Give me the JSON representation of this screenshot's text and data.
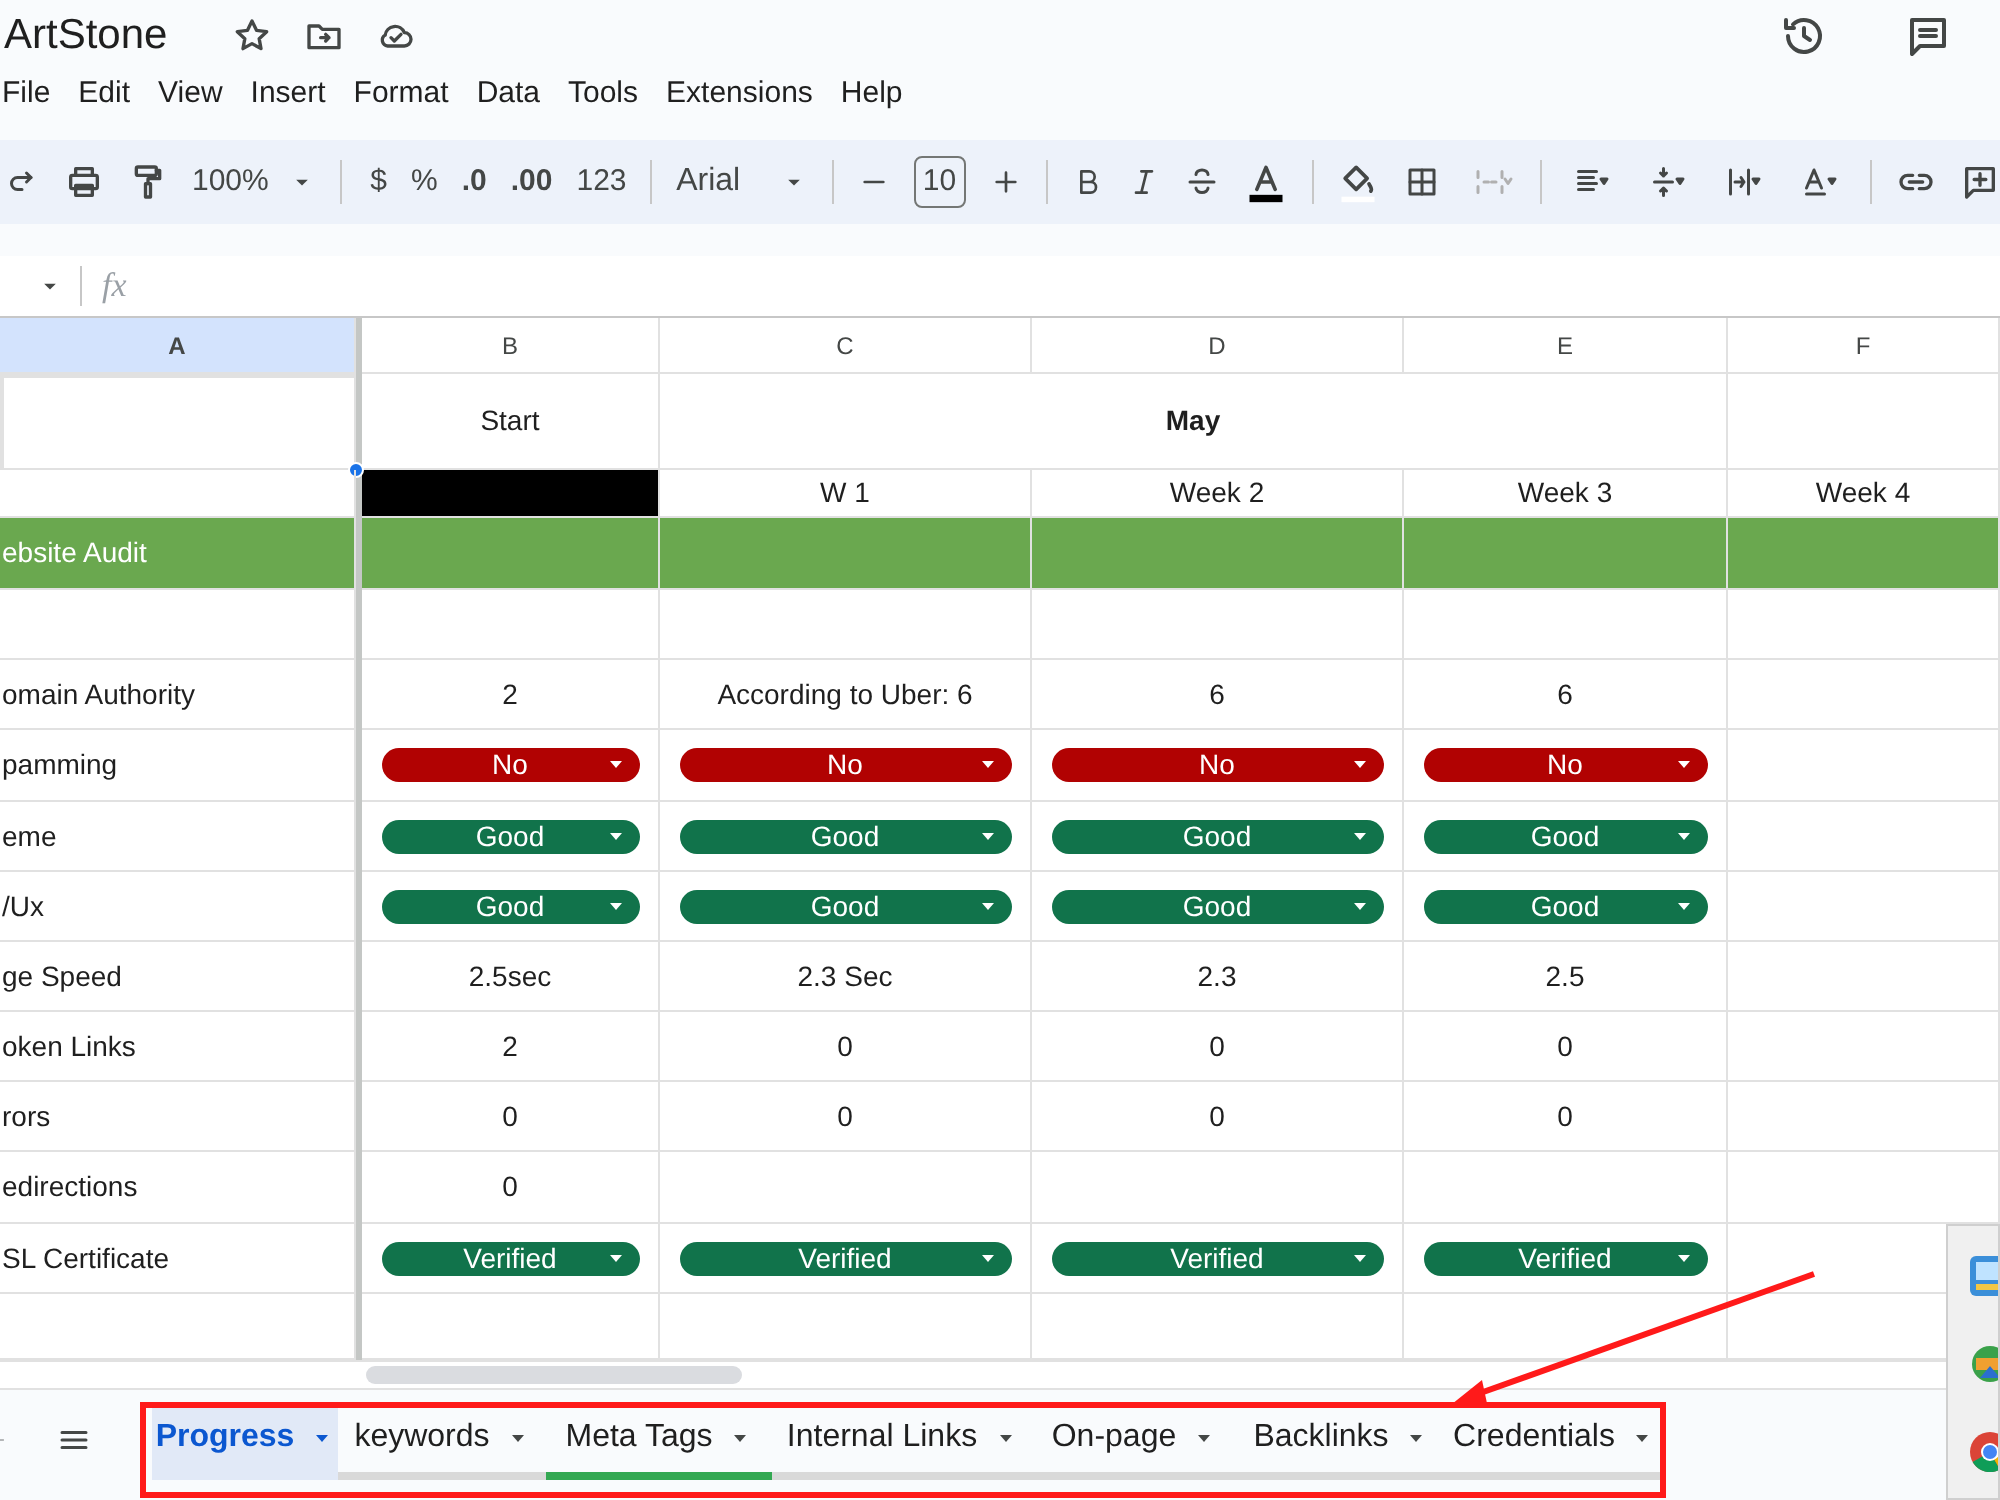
{
  "document": {
    "title": "ArtStone"
  },
  "menu": [
    "File",
    "Edit",
    "View",
    "Insert",
    "Format",
    "Data",
    "Tools",
    "Extensions",
    "Help"
  ],
  "toolbar": {
    "zoom": "100%",
    "currency": "$",
    "percent": "%",
    "decrease_decimal": ".0",
    "increase_decimal": ".00",
    "number_format": "123",
    "font": "Arial",
    "font_size": "10"
  },
  "formula_bar": {
    "fx": "fx"
  },
  "columns": [
    {
      "label": "A",
      "selected": true
    },
    {
      "label": "B",
      "selected": false
    },
    {
      "label": "C",
      "selected": false
    },
    {
      "label": "D",
      "selected": false
    },
    {
      "label": "E",
      "selected": false
    },
    {
      "label": "F",
      "selected": false
    }
  ],
  "rows": [
    {
      "kind": "header",
      "label": "",
      "selected": true,
      "cells": [
        {
          "kind": "text",
          "text": "Start"
        },
        {
          "kind": "merged",
          "text": "May"
        }
      ]
    },
    {
      "kind": "weeks",
      "label": "",
      "selected": false,
      "cells": [
        {
          "kind": "fill",
          "color": "#000000"
        },
        {
          "kind": "text",
          "text": "W 1"
        },
        {
          "kind": "text",
          "text": "Week 2"
        },
        {
          "kind": "text",
          "text": "Week 3"
        },
        {
          "kind": "text",
          "text": "Week 4"
        }
      ]
    },
    {
      "kind": "band",
      "label": "ebsite Audit",
      "selected": false,
      "color": "#6aa84f",
      "cells": []
    },
    {
      "kind": "plain",
      "label": "",
      "selected": false,
      "cells": []
    },
    {
      "kind": "plain",
      "label": "omain Authority",
      "selected": false,
      "cells": [
        {
          "kind": "text",
          "text": "2"
        },
        {
          "kind": "text",
          "text": "According to Uber: 6"
        },
        {
          "kind": "text",
          "text": "6"
        },
        {
          "kind": "text",
          "text": "6"
        }
      ]
    },
    {
      "kind": "plain",
      "label": "pamming",
      "selected": false,
      "cells": [
        {
          "kind": "chip",
          "text": "No",
          "color": "#b10202"
        },
        {
          "kind": "chip",
          "text": "No",
          "color": "#b10202"
        },
        {
          "kind": "chip",
          "text": "No",
          "color": "#b10202"
        },
        {
          "kind": "chip",
          "text": "No",
          "color": "#b10202"
        }
      ]
    },
    {
      "kind": "plain",
      "label": "eme",
      "selected": false,
      "cells": [
        {
          "kind": "chip",
          "text": "Good",
          "color": "#11734b"
        },
        {
          "kind": "chip",
          "text": "Good",
          "color": "#11734b"
        },
        {
          "kind": "chip",
          "text": "Good",
          "color": "#11734b"
        },
        {
          "kind": "chip",
          "text": "Good",
          "color": "#11734b"
        }
      ]
    },
    {
      "kind": "plain",
      "label": "/Ux",
      "selected": false,
      "cells": [
        {
          "kind": "chip",
          "text": "Good",
          "color": "#11734b"
        },
        {
          "kind": "chip",
          "text": "Good",
          "color": "#11734b"
        },
        {
          "kind": "chip",
          "text": "Good",
          "color": "#11734b"
        },
        {
          "kind": "chip",
          "text": "Good",
          "color": "#11734b"
        }
      ]
    },
    {
      "kind": "plain",
      "label": "ge Speed",
      "selected": false,
      "cells": [
        {
          "kind": "text",
          "text": "2.5sec"
        },
        {
          "kind": "text",
          "text": "2.3 Sec"
        },
        {
          "kind": "text",
          "text": "2.3"
        },
        {
          "kind": "text",
          "text": "2.5"
        }
      ]
    },
    {
      "kind": "plain",
      "label": "oken Links",
      "selected": false,
      "cells": [
        {
          "kind": "text",
          "text": "2"
        },
        {
          "kind": "text",
          "text": "0"
        },
        {
          "kind": "text",
          "text": "0"
        },
        {
          "kind": "text",
          "text": "0"
        }
      ]
    },
    {
      "kind": "plain",
      "label": "rors",
      "selected": false,
      "cells": [
        {
          "kind": "text",
          "text": "0"
        },
        {
          "kind": "text",
          "text": "0"
        },
        {
          "kind": "text",
          "text": "0"
        },
        {
          "kind": "text",
          "text": "0"
        }
      ]
    },
    {
      "kind": "plain",
      "label": "edirections",
      "selected": false,
      "cells": [
        {
          "kind": "text",
          "text": "0"
        }
      ]
    },
    {
      "kind": "plain",
      "label": "SL Certificate",
      "selected": false,
      "cells": [
        {
          "kind": "chip",
          "text": "Verified",
          "color": "#11734b"
        },
        {
          "kind": "chip",
          "text": "Verified",
          "color": "#11734b"
        },
        {
          "kind": "chip",
          "text": "Verified",
          "color": "#11734b"
        },
        {
          "kind": "chip",
          "text": "Verified",
          "color": "#11734b"
        }
      ]
    },
    {
      "kind": "plain",
      "label": "",
      "selected": false,
      "cells": []
    }
  ],
  "sheet_tabs": [
    {
      "label": "Progress",
      "selected": true
    },
    {
      "label": "keywords",
      "selected": false
    },
    {
      "label": "Meta Tags",
      "selected": false,
      "color": "#34a853"
    },
    {
      "label": "Internal Links",
      "selected": false
    },
    {
      "label": "On-page",
      "selected": false
    },
    {
      "label": "Backlinks",
      "selected": false
    },
    {
      "label": "Credentials",
      "selected": false
    }
  ]
}
